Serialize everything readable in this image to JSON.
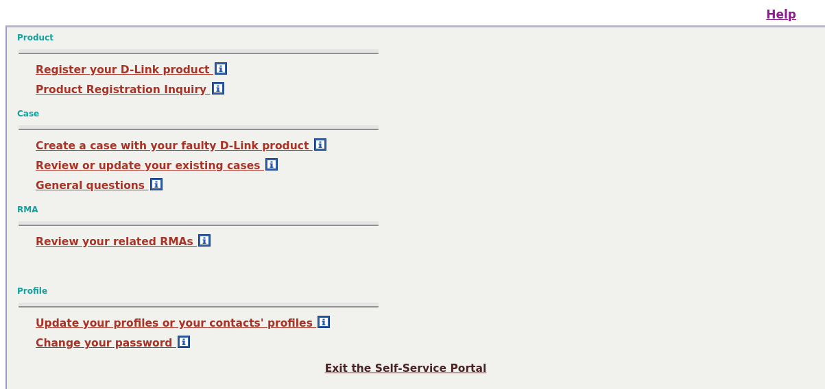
{
  "help_link": "Help",
  "sections": [
    {
      "title": "Product",
      "links": [
        "Register your D-Link product",
        "Product Registration Inquiry"
      ]
    },
    {
      "title": "Case",
      "links": [
        "Create a case with your faulty D-Link product",
        "Review or update your existing cases",
        "General questions"
      ]
    },
    {
      "title": "RMA",
      "links": [
        "Review your related RMAs"
      ]
    },
    {
      "title": "Profile",
      "links": [
        "Update your profiles or your contacts' profiles",
        "Change your password"
      ]
    }
  ],
  "exit_link": "Exit the Self-Service Portal"
}
